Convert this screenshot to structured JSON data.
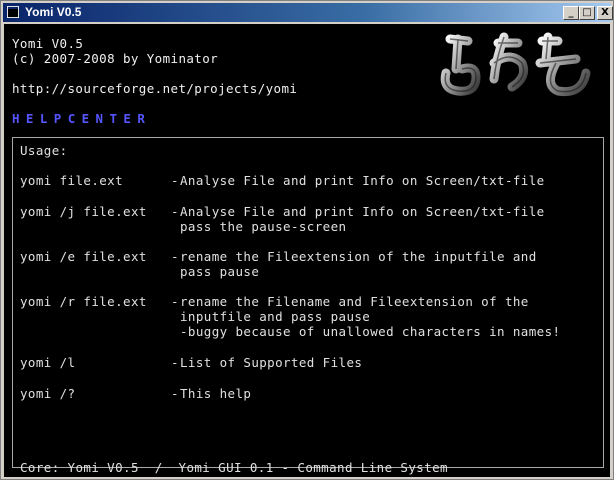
{
  "window": {
    "title": "Yomi V0.5",
    "minimize_label": "_",
    "maximize_label": "□",
    "close_label": "X"
  },
  "header": {
    "line1": "Yomi V0.5",
    "line2": "(c) 2007-2008 by Yominator",
    "url": "http://sourceforge.net/projects/yomi",
    "section": "HELPCENTER"
  },
  "usage": {
    "label": "Usage:",
    "rows": [
      {
        "cmd": "yomi file.ext",
        "desc": [
          "Analyse File and print Info on Screen/txt-file"
        ]
      },
      {
        "cmd": "yomi /j file.ext",
        "desc": [
          "Analyse File and print Info on Screen/txt-file",
          "pass the pause-screen"
        ]
      },
      {
        "cmd": "yomi /e file.ext",
        "desc": [
          "rename the Fileextension of the inputfile and",
          "pass pause"
        ]
      },
      {
        "cmd": "yomi /r file.ext",
        "desc": [
          "rename the Filename and Fileextension of the",
          "inputfile and pass pause",
          "-buggy because of unallowed characters in names!"
        ]
      },
      {
        "cmd": "yomi /l",
        "desc": [
          "List of Supported Files"
        ]
      },
      {
        "cmd": "yomi /?",
        "desc": [
          "This help"
        ]
      }
    ]
  },
  "footer": "Core: Yomi V0.5  /  Yomi GUI 0.1 - Command Line System"
}
